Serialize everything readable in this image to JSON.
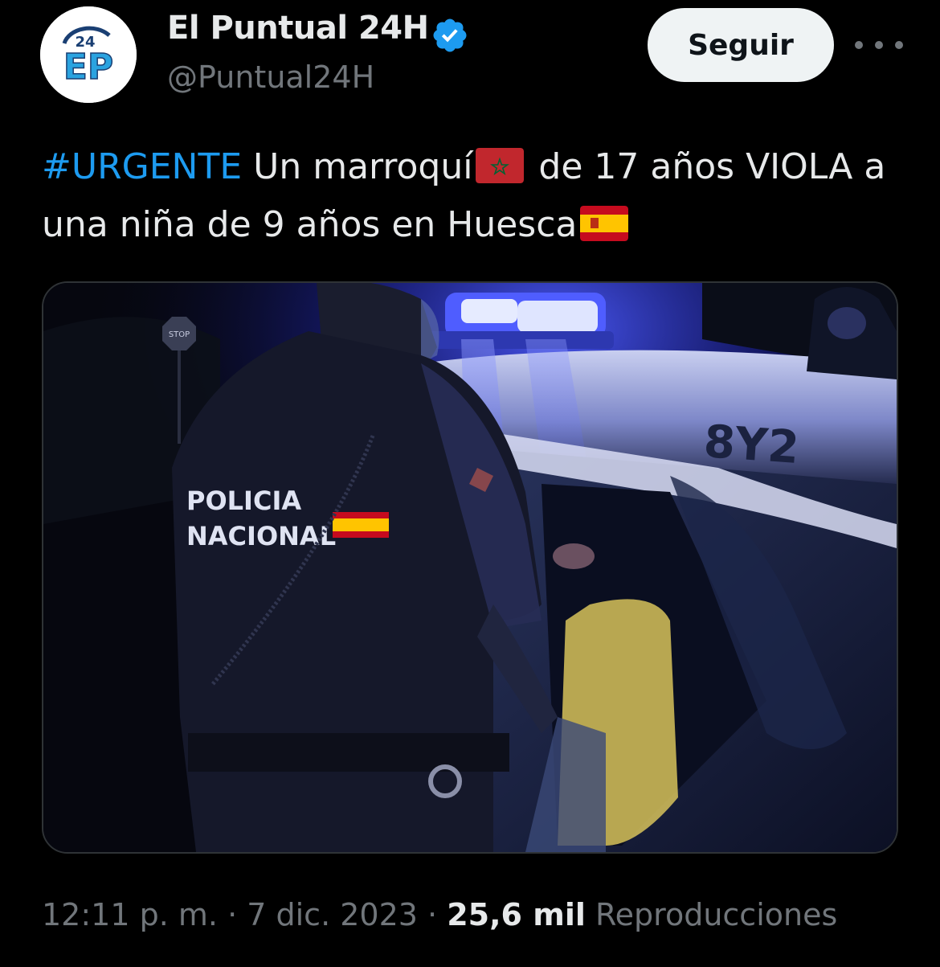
{
  "account": {
    "display_name": "El Puntual 24H",
    "handle": "@Puntual24H",
    "verified": true,
    "avatar_logo_text": "EP 24"
  },
  "actions": {
    "follow_label": "Seguir",
    "more_icon": "more-horizontal-icon"
  },
  "tweet": {
    "hashtag": "#URGENTE",
    "text_part1": " Un marroquí",
    "text_part2": " de 17 años VIOLA a una niña de 9 años en Huesca",
    "flags": [
      "morocco-flag",
      "spain-flag"
    ]
  },
  "media": {
    "vest_line1": "POLICIA",
    "vest_line2": "NACIONAL",
    "car_number": "8Y2",
    "stop_sign": "STOP"
  },
  "meta": {
    "time": "12:11 p. m.",
    "date": "7 dic. 2023",
    "separator": "·",
    "views_count": "25,6 mil",
    "views_label": "Reproducciones"
  },
  "colors": {
    "link": "#1d9bf0",
    "verified": "#1d9bf0",
    "muted": "#71767b",
    "background": "#000000"
  }
}
